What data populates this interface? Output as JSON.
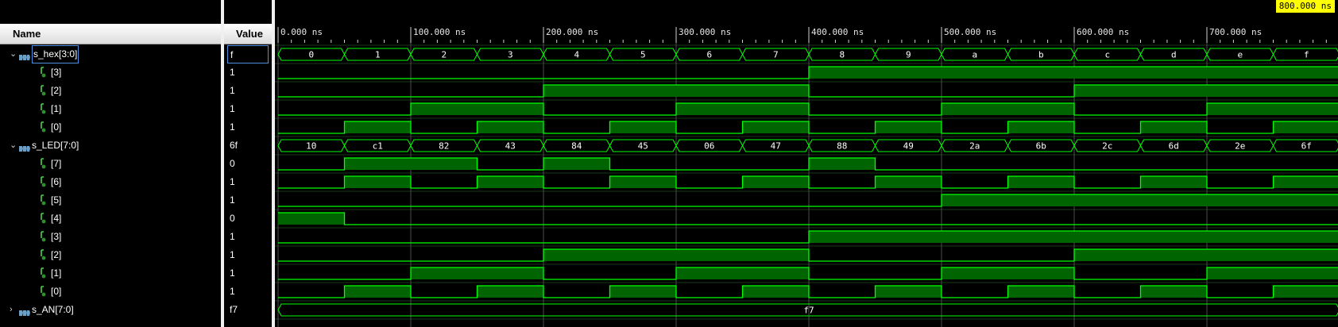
{
  "headers": {
    "name": "Name",
    "value": "Value"
  },
  "colors": {
    "wave": "#00ff00",
    "wave_fill": "#006400",
    "grid": "#4d4d4d",
    "cursor": "#ffff00"
  },
  "timeline": {
    "labels": [
      "0.000 ns",
      "100.000 ns",
      "200.000 ns",
      "300.000 ns",
      "400.000 ns",
      "500.000 ns",
      "600.000 ns",
      "700.000 ns"
    ],
    "cursor_label": "800.000 ns"
  },
  "signals": [
    {
      "name": "s_hex[3:0]",
      "value": "f",
      "kind": "bus",
      "expanded": true,
      "selected": true,
      "segments": [
        "0",
        "1",
        "2",
        "3",
        "4",
        "5",
        "6",
        "7",
        "8",
        "9",
        "a",
        "b",
        "c",
        "d",
        "e",
        "f"
      ]
    },
    {
      "name": "[3]",
      "value": "1",
      "kind": "bit",
      "levels": [
        0,
        0,
        0,
        0,
        0,
        0,
        0,
        0,
        1,
        1,
        1,
        1,
        1,
        1,
        1,
        1
      ]
    },
    {
      "name": "[2]",
      "value": "1",
      "kind": "bit",
      "levels": [
        0,
        0,
        0,
        0,
        1,
        1,
        1,
        1,
        0,
        0,
        0,
        0,
        1,
        1,
        1,
        1
      ]
    },
    {
      "name": "[1]",
      "value": "1",
      "kind": "bit",
      "levels": [
        0,
        0,
        1,
        1,
        0,
        0,
        1,
        1,
        0,
        0,
        1,
        1,
        0,
        0,
        1,
        1
      ]
    },
    {
      "name": "[0]",
      "value": "1",
      "kind": "bit",
      "levels": [
        0,
        1,
        0,
        1,
        0,
        1,
        0,
        1,
        0,
        1,
        0,
        1,
        0,
        1,
        0,
        1
      ]
    },
    {
      "name": "s_LED[7:0]",
      "value": "6f",
      "kind": "bus",
      "expanded": true,
      "segments": [
        "10",
        "c1",
        "82",
        "43",
        "84",
        "45",
        "06",
        "47",
        "88",
        "49",
        "2a",
        "6b",
        "2c",
        "6d",
        "2e",
        "6f"
      ]
    },
    {
      "name": "[7]",
      "value": "0",
      "kind": "bit",
      "levels": [
        0,
        1,
        1,
        0,
        1,
        0,
        0,
        0,
        1,
        0,
        0,
        0,
        0,
        0,
        0,
        0
      ]
    },
    {
      "name": "[6]",
      "value": "1",
      "kind": "bit",
      "levels": [
        0,
        1,
        0,
        1,
        0,
        1,
        0,
        1,
        0,
        1,
        0,
        1,
        0,
        1,
        0,
        1
      ]
    },
    {
      "name": "[5]",
      "value": "1",
      "kind": "bit",
      "levels": [
        0,
        0,
        0,
        0,
        0,
        0,
        0,
        0,
        0,
        0,
        1,
        1,
        1,
        1,
        1,
        1
      ]
    },
    {
      "name": "[4]",
      "value": "0",
      "kind": "bit",
      "levels": [
        1,
        0,
        0,
        0,
        0,
        0,
        0,
        0,
        0,
        0,
        0,
        0,
        0,
        0,
        0,
        0
      ]
    },
    {
      "name": "[3]",
      "value": "1",
      "kind": "bit",
      "levels": [
        0,
        0,
        0,
        0,
        0,
        0,
        0,
        0,
        1,
        1,
        1,
        1,
        1,
        1,
        1,
        1
      ]
    },
    {
      "name": "[2]",
      "value": "1",
      "kind": "bit",
      "levels": [
        0,
        0,
        0,
        0,
        1,
        1,
        1,
        1,
        0,
        0,
        0,
        0,
        1,
        1,
        1,
        1
      ]
    },
    {
      "name": "[1]",
      "value": "1",
      "kind": "bit",
      "levels": [
        0,
        0,
        1,
        1,
        0,
        0,
        1,
        1,
        0,
        0,
        1,
        1,
        0,
        0,
        1,
        1
      ]
    },
    {
      "name": "[0]",
      "value": "1",
      "kind": "bit",
      "levels": [
        0,
        1,
        0,
        1,
        0,
        1,
        0,
        1,
        0,
        1,
        0,
        1,
        0,
        1,
        0,
        1
      ]
    },
    {
      "name": "s_AN[7:0]",
      "value": "f7",
      "kind": "bus",
      "expanded": false,
      "segments": [
        "f7"
      ]
    }
  ]
}
